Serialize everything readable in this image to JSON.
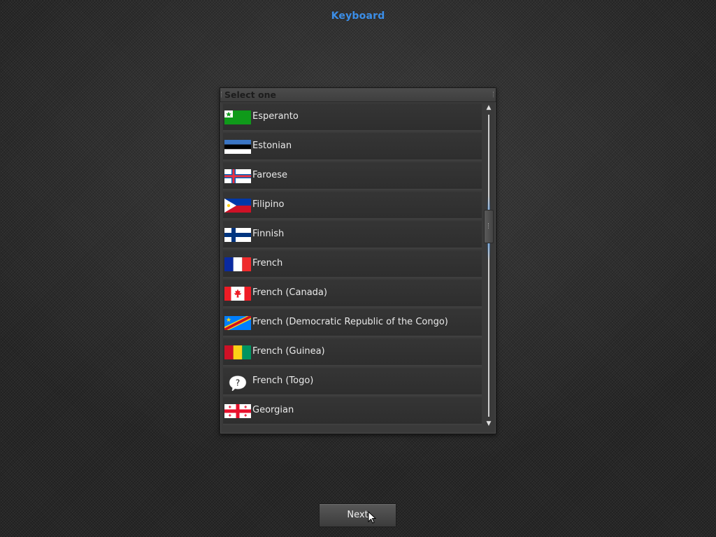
{
  "page": {
    "title": "Keyboard"
  },
  "selector": {
    "title": "Select one",
    "items": [
      {
        "label": "Esperanto",
        "flag": "esperanto-flag-icon"
      },
      {
        "label": "Estonian",
        "flag": "estonia-flag-icon"
      },
      {
        "label": "Faroese",
        "flag": "faroe-islands-flag-icon"
      },
      {
        "label": "Filipino",
        "flag": "philippines-flag-icon"
      },
      {
        "label": "Finnish",
        "flag": "finland-flag-icon"
      },
      {
        "label": "French",
        "flag": "france-flag-icon"
      },
      {
        "label": "French (Canada)",
        "flag": "canada-flag-icon"
      },
      {
        "label": "French (Democratic Republic of the Congo)",
        "flag": "dr-congo-flag-icon"
      },
      {
        "label": "French (Guinea)",
        "flag": "guinea-flag-icon"
      },
      {
        "label": "French (Togo)",
        "flag": "unknown-flag-icon"
      },
      {
        "label": "Georgian",
        "flag": "georgia-flag-icon"
      }
    ]
  },
  "scrollbar": {
    "up_arrow": "▲",
    "down_arrow": "▼"
  },
  "footer": {
    "next_label": "Next"
  },
  "colors": {
    "title_accent": "#3b8ee8",
    "scroll_glow": "#3a8ce6"
  }
}
